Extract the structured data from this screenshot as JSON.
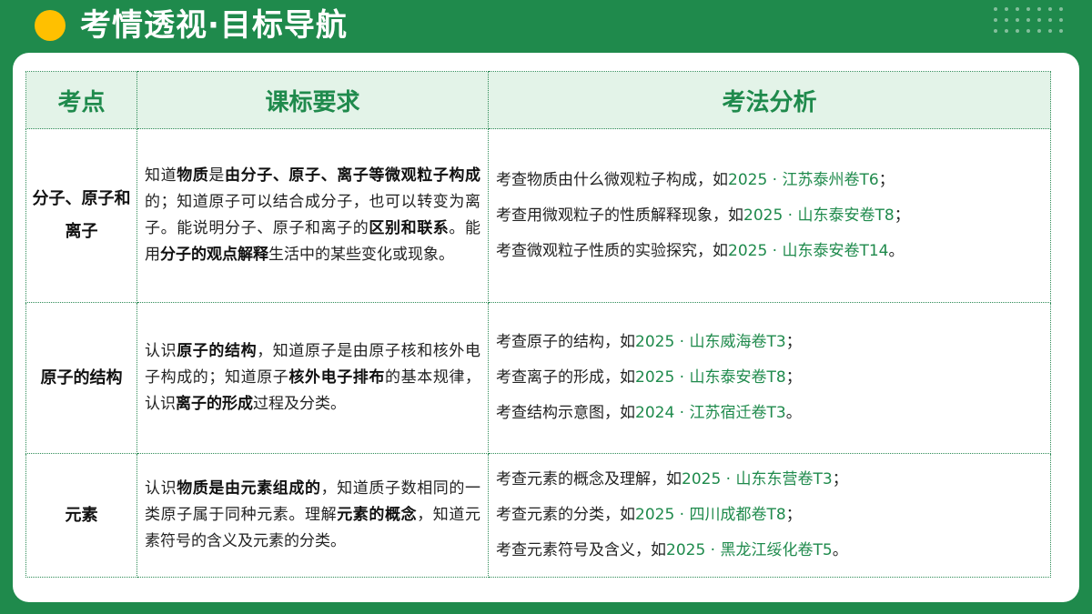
{
  "header": {
    "title": "考情透视·目标导航"
  },
  "colors": {
    "brand": "#1f8a4c",
    "accent": "#ffc000",
    "header_bg": "#e3f3e8"
  },
  "table": {
    "headers": [
      "考点",
      "课标要求",
      "考法分析"
    ],
    "rows": [
      {
        "point": "分子、原子和离子",
        "requirement": [
          {
            "t": "知道",
            "b": false
          },
          {
            "t": "物质",
            "b": true
          },
          {
            "t": "是",
            "b": false
          },
          {
            "t": "由分子、原子、离子等微观粒子构成",
            "b": true
          },
          {
            "t": "的；知道原子可以结合成分子，也可以转变为离子。能说明分子、原子和离子的",
            "b": false
          },
          {
            "t": "区别和联系",
            "b": true
          },
          {
            "t": "。能用",
            "b": false
          },
          {
            "t": "分子的观点解释",
            "b": true
          },
          {
            "t": "生活中的某些变化或现象。",
            "b": false
          }
        ],
        "analysis": [
          {
            "text": "考查物质由什么微观粒子构成，如",
            "source": "2025 · 江苏泰州卷T6",
            "end": "；"
          },
          {
            "text": "考查用微观粒子的性质解释现象，如",
            "source": "2025 · 山东泰安卷T8",
            "end": "；"
          },
          {
            "text": "考查微观粒子性质的实验探究，如",
            "source": "2025 · 山东泰安卷T14",
            "end": "。"
          }
        ]
      },
      {
        "point": "原子的结构",
        "requirement": [
          {
            "t": "认识",
            "b": false
          },
          {
            "t": "原子的结构",
            "b": true
          },
          {
            "t": "，知道原子是由原子核和核外电子构成的；知道原子",
            "b": false
          },
          {
            "t": "核外电子排布",
            "b": true
          },
          {
            "t": "的基本规律，认识",
            "b": false
          },
          {
            "t": "离子的形成",
            "b": true
          },
          {
            "t": "过程及分类。",
            "b": false
          }
        ],
        "analysis": [
          {
            "text": "考查原子的结构，如",
            "source": "2025 · 山东威海卷T3",
            "end": "；"
          },
          {
            "text": "考查离子的形成，如",
            "source": "2025 · 山东泰安卷T8",
            "end": "；"
          },
          {
            "text": "考查结构示意图，如",
            "source": "2024 · 江苏宿迁卷T3",
            "end": "。"
          }
        ]
      },
      {
        "point": "元素",
        "requirement": [
          {
            "t": "认识",
            "b": false
          },
          {
            "t": "物质是由元素组成的",
            "b": true
          },
          {
            "t": "，知道质子数相同的一类原子属于同种元素。理解",
            "b": false
          },
          {
            "t": "元素的概念",
            "b": true
          },
          {
            "t": "，知道元素符号的含义及元素的分类。",
            "b": false
          }
        ],
        "analysis": [
          {
            "text": "考查元素的概念及理解，如",
            "source": "2025 · 山东东营卷T3",
            "end": "；"
          },
          {
            "text": "考查元素的分类，如",
            "source": "2025 · 四川成都卷T8",
            "end": "；"
          },
          {
            "text": "考查元素符号及含义，如",
            "source": "2025 · 黑龙江绥化卷T5",
            "end": "。"
          }
        ]
      }
    ]
  }
}
